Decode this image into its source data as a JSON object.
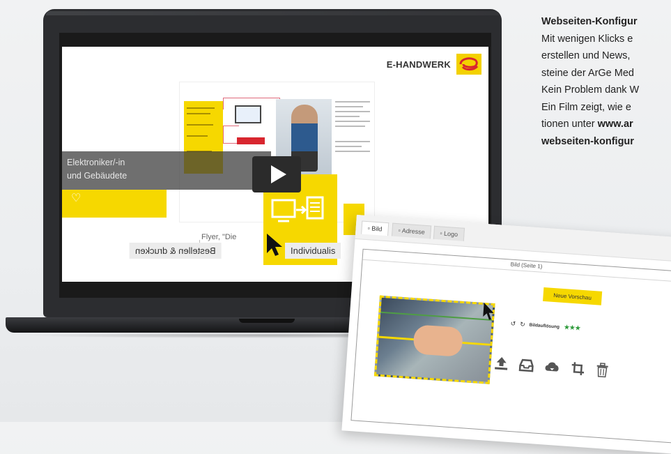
{
  "brand": {
    "name": "E-HANDWERK"
  },
  "flyer": {
    "band_line1": "Elektroniker/-in",
    "band_line2": "und Gebäudete",
    "caption": "Flyer, \"Die",
    "print_button_label": "Bestellen & drucken",
    "print_button_visible": "ɐıǝɹǝu & dɹnɔkǝu",
    "individual_button_label": "Individualis"
  },
  "text_block": {
    "heading": "Webseiten-Konfigur",
    "lines": [
      "Mit wenigen Klicks e",
      "erstellen und News,",
      "steine der ArGe Med",
      "Kein Problem dank W",
      "Ein Film zeigt, wie e",
      "tionen unter "
    ],
    "link_part": "www.ar",
    "link_line2": "webseiten-konfigur"
  },
  "config": {
    "tabs": [
      "Bild",
      "Adresse",
      "Logo"
    ],
    "panel_header": "Bild (Seite 1)",
    "preview_button": "Neue Vorschau",
    "resolution_label": "Bildauflösung",
    "stars": "★★★",
    "icons": [
      "upload-icon",
      "inbox-icon",
      "cloud-download-icon",
      "crop-icon",
      "trash-icon"
    ]
  },
  "colors": {
    "accent": "#f6d800",
    "dark": "#2c2d30",
    "stars": "#2e9b3b"
  }
}
